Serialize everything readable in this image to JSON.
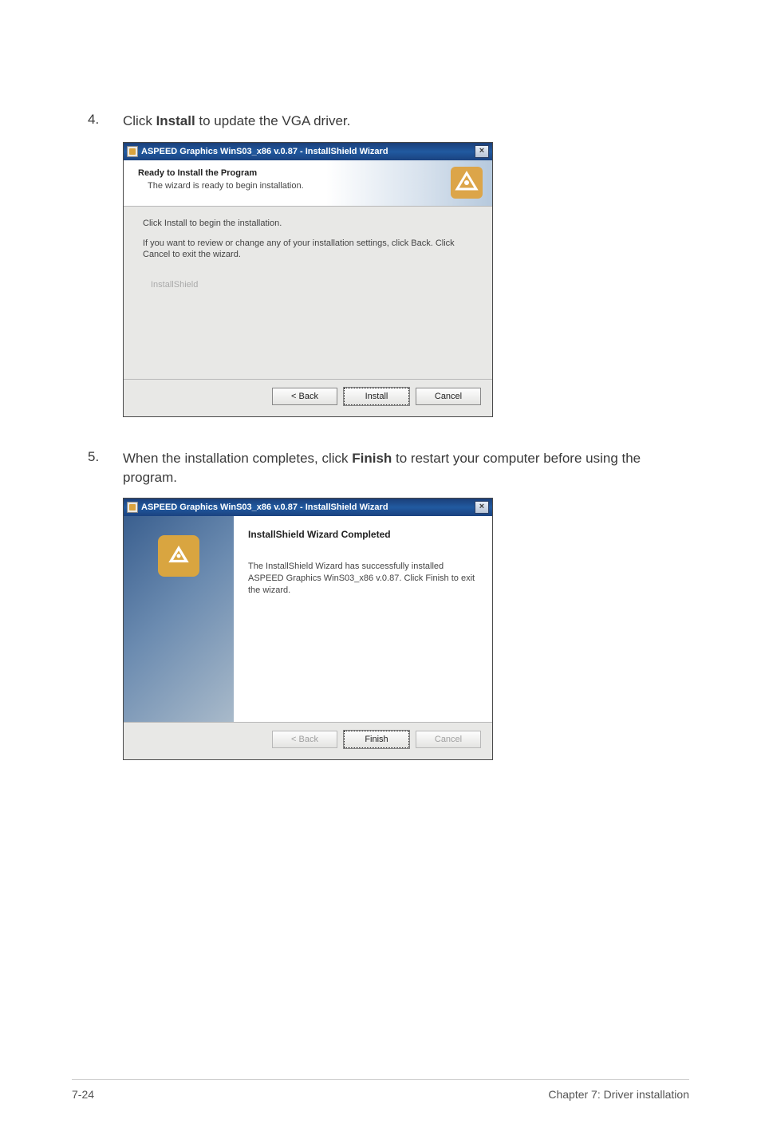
{
  "step4": {
    "num": "4.",
    "text_before": "Click ",
    "bold": "Install",
    "text_after": " to update the VGA driver."
  },
  "step5": {
    "num": "5.",
    "text_before": "When the installation completes, click ",
    "bold": "Finish",
    "text_after": " to restart your computer before using the program."
  },
  "dialog1": {
    "title": "ASPEED Graphics WinS03_x86 v.0.87 - InstallShield Wizard",
    "close": "×",
    "header_title": "Ready to Install the Program",
    "header_sub": "The wizard is ready to begin installation.",
    "body_line1": "Click Install to begin the installation.",
    "body_line2": "If you want to review or change any of your installation settings, click Back. Click Cancel to exit the wizard.",
    "installshield": "InstallShield",
    "btn_back": "< Back",
    "btn_install": "Install",
    "btn_cancel": "Cancel"
  },
  "dialog2": {
    "title": "ASPEED Graphics WinS03_x86 v.0.87 - InstallShield Wizard",
    "close": "×",
    "header_title": "InstallShield Wizard Completed",
    "body_text": "The InstallShield Wizard has successfully installed ASPEED Graphics WinS03_x86 v.0.87. Click Finish to exit the wizard.",
    "btn_back": "< Back",
    "btn_finish": "Finish",
    "btn_cancel": "Cancel"
  },
  "footer": {
    "left": "7-24",
    "right": "Chapter 7: Driver installation"
  }
}
